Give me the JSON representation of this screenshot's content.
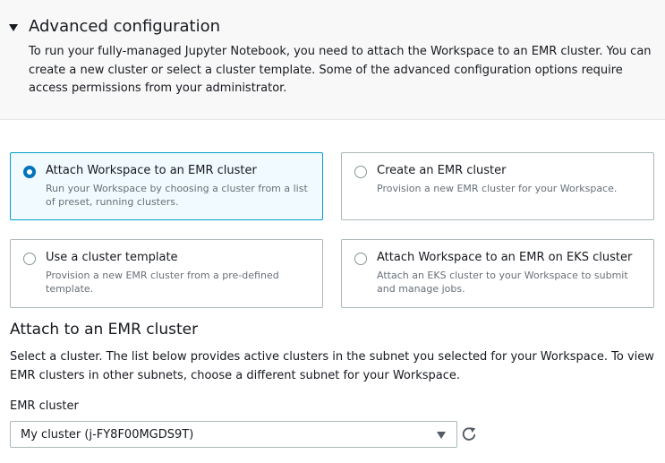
{
  "advanced": {
    "title": "Advanced configuration",
    "description": "To run your fully-managed Jupyter Notebook, you need to attach the Workspace to an EMR cluster. You can create a new cluster or select a cluster template. Some of the advanced configuration options require access permissions from your administrator."
  },
  "options": [
    {
      "title": "Attach Workspace to an EMR cluster",
      "description": "Run your Workspace by choosing a cluster from a list of preset, running clusters.",
      "selected": true
    },
    {
      "title": "Create an EMR cluster",
      "description": "Provision a new EMR cluster for your Workspace.",
      "selected": false
    },
    {
      "title": "Use a cluster template",
      "description": "Provision a new EMR cluster from a pre-defined template.",
      "selected": false
    },
    {
      "title": "Attach Workspace to an EMR on EKS cluster",
      "description": "Attach an EKS cluster to your Workspace to submit and manage jobs.",
      "selected": false
    }
  ],
  "attach": {
    "title": "Attach to an EMR cluster",
    "description": "Select a cluster. The list below provides active clusters in the subnet you selected for your Workspace. To view EMR clusters in other subnets, choose a different subnet for your Workspace.",
    "field_label": "EMR cluster",
    "selected_cluster": "My cluster (j-FY8F00MGDS9T)"
  },
  "colors": {
    "selected_border": "#00a1c9",
    "selected_bg": "#f1faff",
    "radio_selected": "#0073bb"
  },
  "icons": {
    "caret": "caret-down-icon",
    "dropdown": "chevron-down-icon",
    "refresh": "refresh-icon"
  }
}
